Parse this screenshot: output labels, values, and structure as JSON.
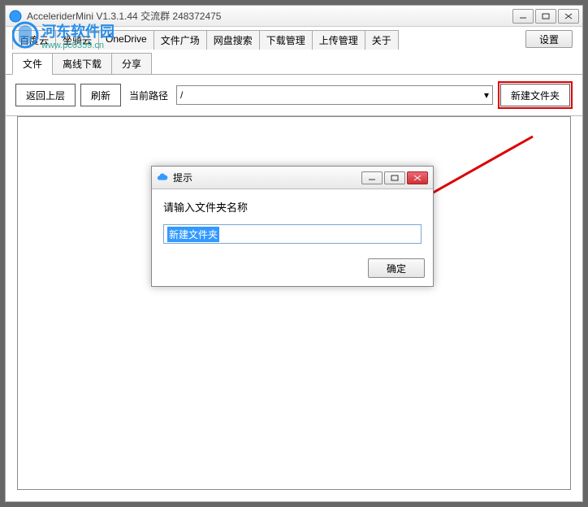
{
  "window": {
    "title": "AcceleriderMini V1.3.1.44   交流群 248372475"
  },
  "settings_label": "设置",
  "tabs_top": [
    "百度云",
    "坐骑云",
    "OneDrive",
    "文件广场",
    "网盘搜索",
    "下载管理",
    "上传管理",
    "关于"
  ],
  "tabs_sub": [
    {
      "label": "文件",
      "active": true
    },
    {
      "label": "离线下载",
      "active": false
    },
    {
      "label": "分享",
      "active": false
    }
  ],
  "toolbar": {
    "back": "返回上层",
    "refresh": "刷新",
    "path_label": "当前路径",
    "path_value": "/",
    "new_folder": "新建文件夹"
  },
  "dialog": {
    "title": "提示",
    "prompt": "请输入文件夹名称",
    "input_value": "新建文件夹",
    "ok": "确定"
  },
  "watermark": {
    "line1": "河东软件园",
    "line2": "www.pc0359.cn"
  }
}
